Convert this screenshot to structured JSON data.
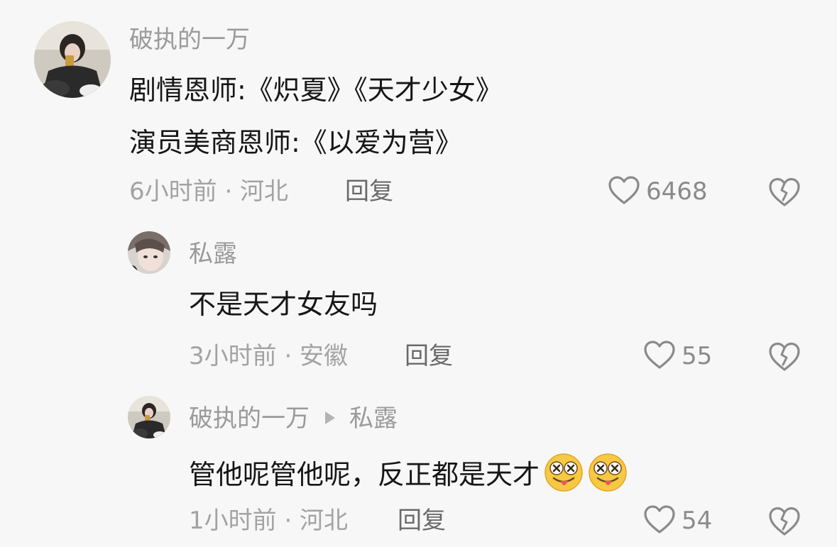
{
  "comments": [
    {
      "username": "破执的一万",
      "lines": [
        "剧情恩师:《炽夏》《天才少女》",
        "演员美商恩师:《以爱为营》"
      ],
      "time": "6小时前 · 河北",
      "reply": "回复",
      "likes": "6468",
      "avatar": "avatar-girl-phone"
    },
    {
      "username": "私露",
      "lines": [
        "不是天才女友吗"
      ],
      "time": "3小时前 · 安徽",
      "reply": "回复",
      "likes": "55",
      "avatar": "avatar-girl-face"
    },
    {
      "username": "破执的一万",
      "reply_to": "私露",
      "lines": [
        "管他呢管他呢，反正都是天才"
      ],
      "emojis": [
        "face-tongue-eyes-emoji",
        "face-tongue-eyes-emoji"
      ],
      "time": "1小时前 · 河北",
      "reply": "回复",
      "likes": "54",
      "avatar": "avatar-girl-phone"
    }
  ],
  "icons": {
    "like": "heart-outline-icon",
    "dislike": "broken-heart-icon"
  },
  "colors": {
    "background": "#f7f7f7",
    "text": "#161616",
    "secondary": "#9a9a9a",
    "reply": "#6a6a6a"
  }
}
